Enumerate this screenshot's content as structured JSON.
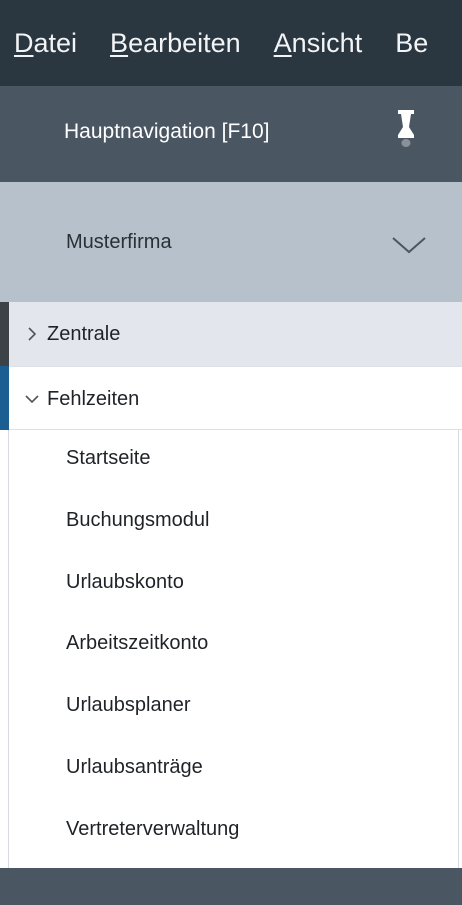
{
  "menubar": {
    "items": [
      {
        "accel": "D",
        "rest": "atei"
      },
      {
        "accel": "B",
        "rest": "earbeiten"
      },
      {
        "accel": "A",
        "rest": "nsicht"
      },
      {
        "accel": "",
        "rest": "Be"
      }
    ]
  },
  "nav": {
    "title": "Hauptnavigation [F10]",
    "pin_icon": "pin-icon"
  },
  "company": {
    "name": "Musterfirma",
    "chevron_icon": "chevron-down-icon"
  },
  "tree": {
    "zentrale": {
      "label": "Zentrale",
      "icon": "chevron-right-icon"
    },
    "fehlzeiten": {
      "label": "Fehlzeiten",
      "icon": "chevron-down-icon"
    },
    "children": [
      {
        "label": "Startseite"
      },
      {
        "label": "Buchungsmodul"
      },
      {
        "label": "Urlaubskonto"
      },
      {
        "label": "Arbeitszeitkonto"
      },
      {
        "label": "Urlaubsplaner"
      },
      {
        "label": "Urlaubsanträge"
      },
      {
        "label": "Vertreterverwaltung"
      }
    ]
  },
  "colors": {
    "menubar_bg": "#2b3740",
    "header_bg": "#4a5763",
    "company_bg": "#b6c1cc",
    "selected_row_bg": "#e3e6ec",
    "accent_blue": "#1b5f92"
  }
}
